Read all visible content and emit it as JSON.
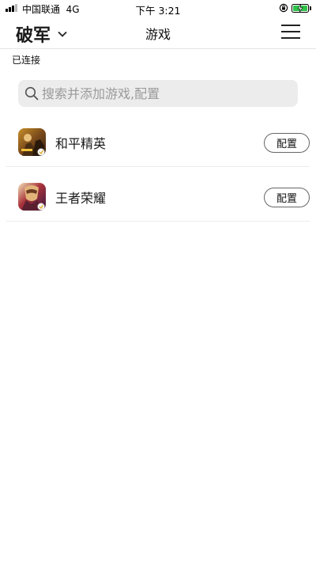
{
  "status_bar": {
    "carrier": "中国联通",
    "network": "4G",
    "time": "下午 3:21",
    "battery_icon": "battery-charging-icon"
  },
  "nav": {
    "device_name": "破军",
    "title": "游戏"
  },
  "connection_status": "已连接",
  "search": {
    "placeholder": "搜索并添加游戏,配置"
  },
  "games": [
    {
      "name": "和平精英",
      "config_label": "配置",
      "icon": "peace-elite-game-icon"
    },
    {
      "name": "王者荣耀",
      "config_label": "配置",
      "icon": "honor-of-kings-game-icon"
    }
  ],
  "colors": {
    "battery_fill": "#2fc24a",
    "search_bg": "#ececec",
    "divider": "#ececec"
  }
}
